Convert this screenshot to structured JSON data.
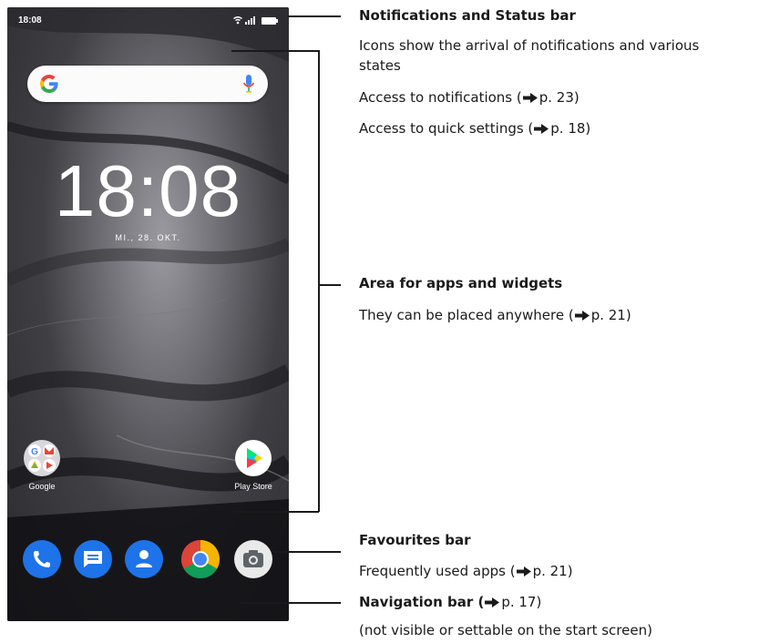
{
  "phone": {
    "status_time": "18:08",
    "clock": "18:08",
    "date": "MI., 28. OKT.",
    "apps": [
      {
        "label": "Google",
        "icon": "google-folder-icon"
      },
      {
        "label": "Play Store",
        "icon": "play-store-icon"
      }
    ],
    "favourites": [
      {
        "icon": "phone-icon",
        "color": "#1e73e8"
      },
      {
        "icon": "messages-icon",
        "color": "#1e73e8"
      },
      {
        "icon": "contacts-icon",
        "color": "#1e73e8"
      },
      {
        "icon": "chrome-icon",
        "color": "#db4437"
      },
      {
        "icon": "camera-icon",
        "color": "#e9e9e9"
      }
    ]
  },
  "annotations": {
    "status": {
      "heading": "Notifications and Status bar",
      "line1": "Icons show the arrival of notifications and various",
      "line2": "states",
      "access_notifications": "Access to notifications (",
      "access_notifications_page": "p. 23)",
      "access_quick": "Access to quick settings (",
      "access_quick_page": "p. 18)"
    },
    "apps_area": {
      "heading": "Area for apps and widgets",
      "line": "They can be placed anywhere (",
      "page": "p. 21)"
    },
    "favourites": {
      "heading": "Favourites bar",
      "line": "Frequently used apps (",
      "page": "p. 21)"
    },
    "navigation": {
      "heading": "Navigation bar (",
      "heading_page": "p. 17)",
      "line": "(not visible or settable on the start screen)"
    }
  }
}
